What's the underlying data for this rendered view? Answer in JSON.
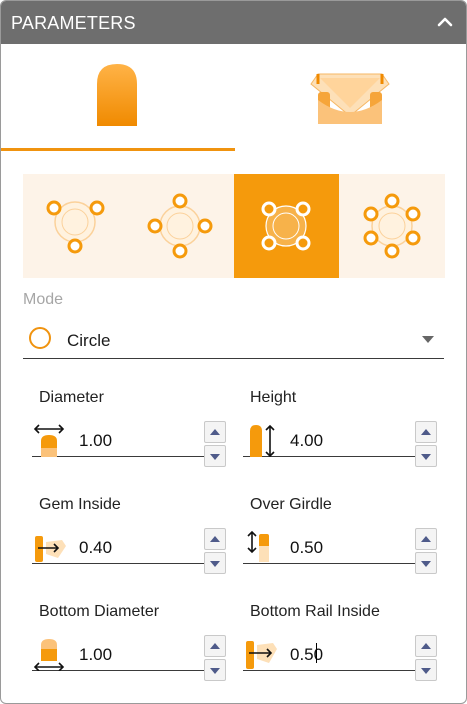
{
  "header": {
    "title": "PARAMETERS",
    "collapse_icon": "chevron-up-icon"
  },
  "tabs": [
    {
      "name": "prong-tab",
      "icon": "prong-shape-icon",
      "selected": true
    },
    {
      "name": "setting-tab",
      "icon": "gem-setting-icon",
      "selected": false
    }
  ],
  "patterns": [
    {
      "name": "three-prong-pattern",
      "selected": false
    },
    {
      "name": "four-prong-diamond-pattern",
      "selected": false
    },
    {
      "name": "four-prong-square-pattern",
      "selected": true
    },
    {
      "name": "six-prong-pattern",
      "selected": false
    }
  ],
  "mode": {
    "label": "Mode",
    "value": "Circle",
    "icon": "circle-icon"
  },
  "fields": {
    "diameter": {
      "label": "Diameter",
      "value": "1.00",
      "icon": "diameter-icon"
    },
    "height": {
      "label": "Height",
      "value": "4.00",
      "icon": "height-icon"
    },
    "gem_inside": {
      "label": "Gem Inside",
      "value": "0.40",
      "icon": "gem-inside-icon"
    },
    "over_girdle": {
      "label": "Over Girdle",
      "value": "0.50",
      "icon": "over-girdle-icon"
    },
    "bottom_diameter": {
      "label": "Bottom Diameter",
      "value": "1.00",
      "icon": "bottom-diameter-icon"
    },
    "bottom_rail_inside": {
      "label": "Bottom Rail Inside",
      "value": "0.50",
      "icon": "bottom-rail-inside-icon"
    }
  },
  "colors": {
    "accent": "#f59a0c",
    "header_bg": "#6e6e6e",
    "pattern_bg": "#fdf3e8"
  }
}
